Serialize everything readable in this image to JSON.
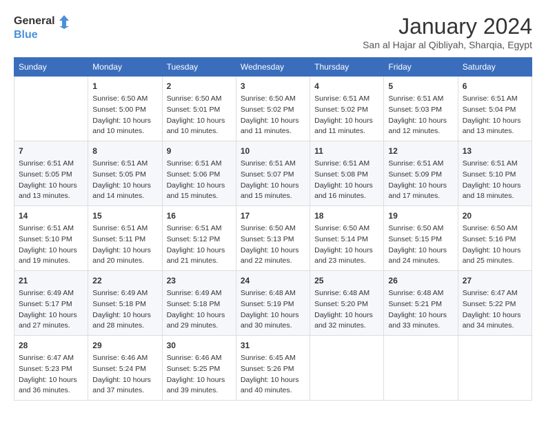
{
  "header": {
    "logo_line1": "General",
    "logo_line2": "Blue",
    "month_title": "January 2024",
    "location": "San al Hajar al Qibliyah, Sharqia, Egypt"
  },
  "weekdays": [
    "Sunday",
    "Monday",
    "Tuesday",
    "Wednesday",
    "Thursday",
    "Friday",
    "Saturday"
  ],
  "weeks": [
    [
      {
        "day": "",
        "sunrise": "",
        "sunset": "",
        "daylight": ""
      },
      {
        "day": "1",
        "sunrise": "Sunrise: 6:50 AM",
        "sunset": "Sunset: 5:00 PM",
        "daylight": "Daylight: 10 hours and 10 minutes."
      },
      {
        "day": "2",
        "sunrise": "Sunrise: 6:50 AM",
        "sunset": "Sunset: 5:01 PM",
        "daylight": "Daylight: 10 hours and 10 minutes."
      },
      {
        "day": "3",
        "sunrise": "Sunrise: 6:50 AM",
        "sunset": "Sunset: 5:02 PM",
        "daylight": "Daylight: 10 hours and 11 minutes."
      },
      {
        "day": "4",
        "sunrise": "Sunrise: 6:51 AM",
        "sunset": "Sunset: 5:02 PM",
        "daylight": "Daylight: 10 hours and 11 minutes."
      },
      {
        "day": "5",
        "sunrise": "Sunrise: 6:51 AM",
        "sunset": "Sunset: 5:03 PM",
        "daylight": "Daylight: 10 hours and 12 minutes."
      },
      {
        "day": "6",
        "sunrise": "Sunrise: 6:51 AM",
        "sunset": "Sunset: 5:04 PM",
        "daylight": "Daylight: 10 hours and 13 minutes."
      }
    ],
    [
      {
        "day": "7",
        "sunrise": "Sunrise: 6:51 AM",
        "sunset": "Sunset: 5:05 PM",
        "daylight": "Daylight: 10 hours and 13 minutes."
      },
      {
        "day": "8",
        "sunrise": "Sunrise: 6:51 AM",
        "sunset": "Sunset: 5:05 PM",
        "daylight": "Daylight: 10 hours and 14 minutes."
      },
      {
        "day": "9",
        "sunrise": "Sunrise: 6:51 AM",
        "sunset": "Sunset: 5:06 PM",
        "daylight": "Daylight: 10 hours and 15 minutes."
      },
      {
        "day": "10",
        "sunrise": "Sunrise: 6:51 AM",
        "sunset": "Sunset: 5:07 PM",
        "daylight": "Daylight: 10 hours and 15 minutes."
      },
      {
        "day": "11",
        "sunrise": "Sunrise: 6:51 AM",
        "sunset": "Sunset: 5:08 PM",
        "daylight": "Daylight: 10 hours and 16 minutes."
      },
      {
        "day": "12",
        "sunrise": "Sunrise: 6:51 AM",
        "sunset": "Sunset: 5:09 PM",
        "daylight": "Daylight: 10 hours and 17 minutes."
      },
      {
        "day": "13",
        "sunrise": "Sunrise: 6:51 AM",
        "sunset": "Sunset: 5:10 PM",
        "daylight": "Daylight: 10 hours and 18 minutes."
      }
    ],
    [
      {
        "day": "14",
        "sunrise": "Sunrise: 6:51 AM",
        "sunset": "Sunset: 5:10 PM",
        "daylight": "Daylight: 10 hours and 19 minutes."
      },
      {
        "day": "15",
        "sunrise": "Sunrise: 6:51 AM",
        "sunset": "Sunset: 5:11 PM",
        "daylight": "Daylight: 10 hours and 20 minutes."
      },
      {
        "day": "16",
        "sunrise": "Sunrise: 6:51 AM",
        "sunset": "Sunset: 5:12 PM",
        "daylight": "Daylight: 10 hours and 21 minutes."
      },
      {
        "day": "17",
        "sunrise": "Sunrise: 6:50 AM",
        "sunset": "Sunset: 5:13 PM",
        "daylight": "Daylight: 10 hours and 22 minutes."
      },
      {
        "day": "18",
        "sunrise": "Sunrise: 6:50 AM",
        "sunset": "Sunset: 5:14 PM",
        "daylight": "Daylight: 10 hours and 23 minutes."
      },
      {
        "day": "19",
        "sunrise": "Sunrise: 6:50 AM",
        "sunset": "Sunset: 5:15 PM",
        "daylight": "Daylight: 10 hours and 24 minutes."
      },
      {
        "day": "20",
        "sunrise": "Sunrise: 6:50 AM",
        "sunset": "Sunset: 5:16 PM",
        "daylight": "Daylight: 10 hours and 25 minutes."
      }
    ],
    [
      {
        "day": "21",
        "sunrise": "Sunrise: 6:49 AM",
        "sunset": "Sunset: 5:17 PM",
        "daylight": "Daylight: 10 hours and 27 minutes."
      },
      {
        "day": "22",
        "sunrise": "Sunrise: 6:49 AM",
        "sunset": "Sunset: 5:18 PM",
        "daylight": "Daylight: 10 hours and 28 minutes."
      },
      {
        "day": "23",
        "sunrise": "Sunrise: 6:49 AM",
        "sunset": "Sunset: 5:18 PM",
        "daylight": "Daylight: 10 hours and 29 minutes."
      },
      {
        "day": "24",
        "sunrise": "Sunrise: 6:48 AM",
        "sunset": "Sunset: 5:19 PM",
        "daylight": "Daylight: 10 hours and 30 minutes."
      },
      {
        "day": "25",
        "sunrise": "Sunrise: 6:48 AM",
        "sunset": "Sunset: 5:20 PM",
        "daylight": "Daylight: 10 hours and 32 minutes."
      },
      {
        "day": "26",
        "sunrise": "Sunrise: 6:48 AM",
        "sunset": "Sunset: 5:21 PM",
        "daylight": "Daylight: 10 hours and 33 minutes."
      },
      {
        "day": "27",
        "sunrise": "Sunrise: 6:47 AM",
        "sunset": "Sunset: 5:22 PM",
        "daylight": "Daylight: 10 hours and 34 minutes."
      }
    ],
    [
      {
        "day": "28",
        "sunrise": "Sunrise: 6:47 AM",
        "sunset": "Sunset: 5:23 PM",
        "daylight": "Daylight: 10 hours and 36 minutes."
      },
      {
        "day": "29",
        "sunrise": "Sunrise: 6:46 AM",
        "sunset": "Sunset: 5:24 PM",
        "daylight": "Daylight: 10 hours and 37 minutes."
      },
      {
        "day": "30",
        "sunrise": "Sunrise: 6:46 AM",
        "sunset": "Sunset: 5:25 PM",
        "daylight": "Daylight: 10 hours and 39 minutes."
      },
      {
        "day": "31",
        "sunrise": "Sunrise: 6:45 AM",
        "sunset": "Sunset: 5:26 PM",
        "daylight": "Daylight: 10 hours and 40 minutes."
      },
      {
        "day": "",
        "sunrise": "",
        "sunset": "",
        "daylight": ""
      },
      {
        "day": "",
        "sunrise": "",
        "sunset": "",
        "daylight": ""
      },
      {
        "day": "",
        "sunrise": "",
        "sunset": "",
        "daylight": ""
      }
    ]
  ]
}
